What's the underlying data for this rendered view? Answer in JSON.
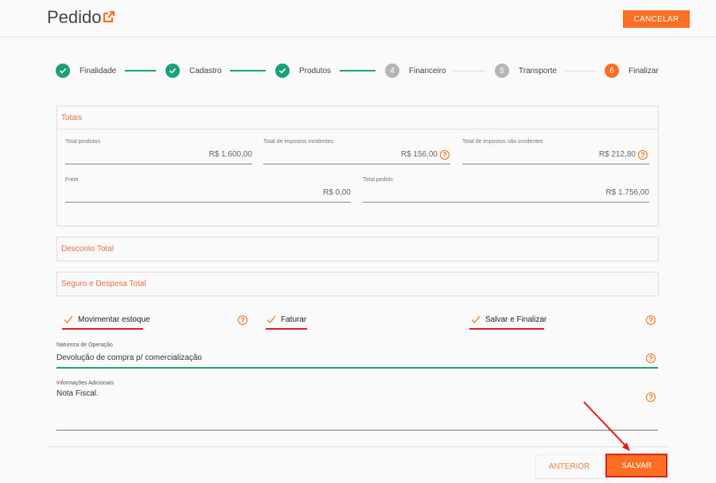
{
  "header": {
    "title": "Pedido",
    "cancel_label": "CANCELAR"
  },
  "stepper": [
    {
      "num": "",
      "label": "Finalidade",
      "state": "done"
    },
    {
      "num": "",
      "label": "Cadastro",
      "state": "done"
    },
    {
      "num": "",
      "label": "Produtos",
      "state": "done"
    },
    {
      "num": "4",
      "label": "Financeiro",
      "state": "pending"
    },
    {
      "num": "5",
      "label": "Transporte",
      "state": "pending"
    },
    {
      "num": "6",
      "label": "Finalizar",
      "state": "active"
    }
  ],
  "totais": {
    "title": "Totais",
    "total_produtos_label": "Total produtos",
    "total_produtos_value": "R$ 1.600,00",
    "impostos_inc_label": "Total de impostos incidentes",
    "impostos_inc_value": "R$ 156,00",
    "impostos_nao_label": "Total de impostos não incidentes",
    "impostos_nao_value": "R$ 212,80",
    "frete_label": "Frete",
    "frete_value": "R$ 0,00",
    "total_pedido_label": "Total pedido",
    "total_pedido_value": "R$ 1.756,00"
  },
  "desconto": {
    "title": "Desconto Total"
  },
  "seguro": {
    "title": "Seguro e Despesa Total"
  },
  "checks": {
    "movimentar": "Movimentar estoque",
    "faturar": "Faturar",
    "salvar_finalizar": "Salvar e Finalizar"
  },
  "natureza": {
    "label": "Natureza de Operação",
    "value": "Devolução de compra p/ comercialização"
  },
  "informacoes": {
    "label": "Informações Adicionais",
    "value": "Nota Fiscal."
  },
  "footer": {
    "anterior_label": "ANTERIOR",
    "salvar_label": "SALVAR"
  },
  "colors": {
    "accent": "#ff6f21",
    "success": "#1aa17a",
    "highlight": "#e02020"
  }
}
